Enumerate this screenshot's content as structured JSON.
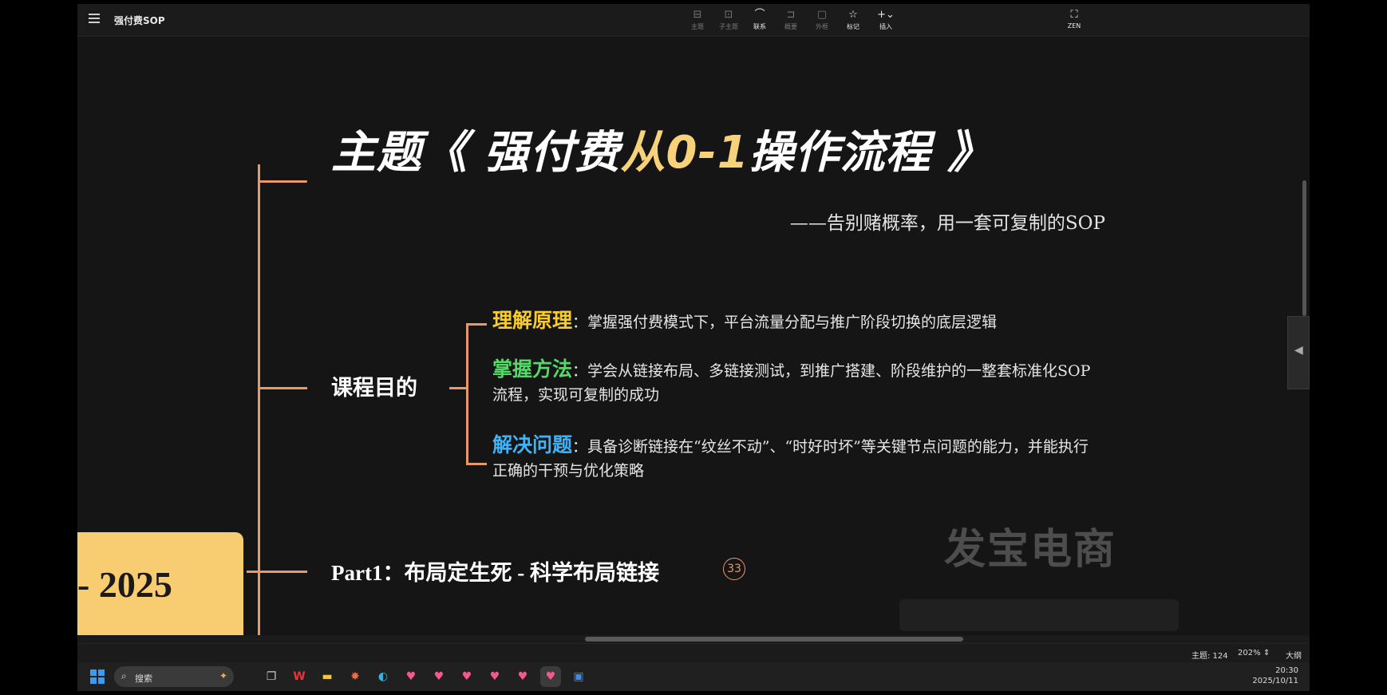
{
  "app": {
    "doc_title": "强付费SOP"
  },
  "toolbar": {
    "items": [
      {
        "name": "topic",
        "label": "主题",
        "icon": "⊟"
      },
      {
        "name": "subtopic",
        "label": "子主题",
        "icon": "⊡"
      },
      {
        "name": "relation",
        "label": "联系",
        "icon": "⌒"
      },
      {
        "name": "summary",
        "label": "概要",
        "icon": "⊐"
      },
      {
        "name": "boundary",
        "label": "外框",
        "icon": "▢"
      },
      {
        "name": "marker",
        "label": "标记",
        "icon": "☆"
      },
      {
        "name": "insert",
        "label": "插入",
        "icon": "+⌄"
      },
      {
        "name": "zen",
        "label": "ZEN",
        "icon": "⛶"
      }
    ]
  },
  "mindmap": {
    "title_prefix": "主题《 强付费",
    "title_highlight": "从0-1",
    "title_suffix": "操作流程 》",
    "subtitle": "——告别赌概率，用一套可复制的SOP",
    "goal_node": "课程目的",
    "goals": [
      {
        "key": "理解原理",
        "text": "：掌握强付费模式下，平台流量分配与推广阶段切换的底层逻辑"
      },
      {
        "key": "掌握方法",
        "text": "：学会从链接布局、多链接测试，到推广搭建、阶段维护的一整套标准化SOP流程，实现可复制的成功"
      },
      {
        "key": "解决问题",
        "text": "：具备诊断链接在“纹丝不动”、“时好时坏”等关键节点问题的能力，并能执行正确的干预与优化策略"
      }
    ],
    "part1": "Part1：布局定生死 - 科学布局链接",
    "part1_badge": "33",
    "year_label": "- 2025",
    "watermark": "发宝电商",
    "accent_color": "#e7996a"
  },
  "status_bar": {
    "topic_count": "主题: 124",
    "zoom": "202%",
    "outline": "大纲"
  },
  "taskbar": {
    "search_placeholder": "搜索",
    "time": "20:30",
    "date": "2025/10/11"
  }
}
